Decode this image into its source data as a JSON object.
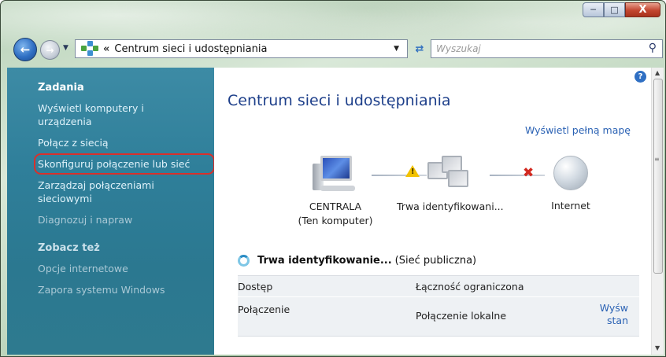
{
  "window": {
    "minimize_icon": "minimize-icon",
    "maximize_icon": "maximize-icon",
    "close_glyph": "X"
  },
  "nav": {
    "back_icon": "back-arrow-icon",
    "forward_icon": "forward-arrow-icon",
    "address_crumb": "«",
    "address_text": "Centrum sieci i udostępniania",
    "search_placeholder": "Wyszukaj"
  },
  "sidebar": {
    "tasks_heading": "Zadania",
    "tasks": [
      {
        "label": "Wyświetl komputery i urządzenia"
      },
      {
        "label": "Połącz z siecią"
      },
      {
        "label": "Skonfiguruj połączenie lub sieć"
      },
      {
        "label": "Zarządzaj połączeniami sieciowymi"
      },
      {
        "label": "Diagnozuj i napraw"
      }
    ],
    "see_also_heading": "Zobacz też",
    "see_also": [
      {
        "label": "Opcje internetowe"
      },
      {
        "label": "Zapora systemu Windows"
      }
    ]
  },
  "main": {
    "title": "Centrum sieci i udostępniania",
    "map_link": "Wyświetl pełną mapę",
    "nodes": {
      "computer_name": "CENTRALA",
      "computer_sub": "(Ten komputer)",
      "network_name": "Trwa identyfikowani...",
      "internet_name": "Internet"
    },
    "status": {
      "name": "Trwa identyfikowanie...",
      "type": "(Sieć publiczna)"
    },
    "table": {
      "access_label": "Dostęp",
      "access_value": "Łączność ograniczona",
      "connection_label": "Połączenie",
      "connection_value": "Połączenie lokalne",
      "view_status_line1": "Wyśw",
      "view_status_line2": "stan"
    }
  }
}
